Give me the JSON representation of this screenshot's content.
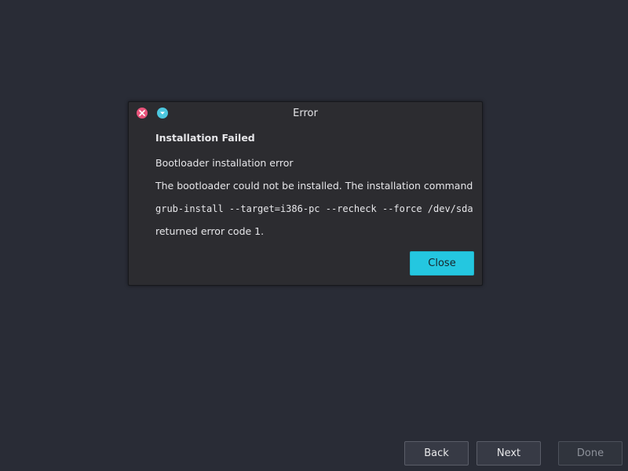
{
  "dialog": {
    "title": "Error",
    "close_icon": "close-circle-icon",
    "minimize_icon": "minimize-chevron-icon",
    "heading": "Installation Failed",
    "line1": "Bootloader installation error",
    "line2": "The bootloader could not be installed. The installation command",
    "command": "grub-install --target=i386-pc --recheck --force /dev/sda",
    "line3": "returned error code 1.",
    "close_button": "Close"
  },
  "navigation": {
    "back": "Back",
    "next": "Next",
    "done": "Done"
  },
  "colors": {
    "background": "#292c36",
    "dialog_bg": "#2c2c30",
    "accent": "#24c7e0",
    "close_red": "#e8537a"
  }
}
